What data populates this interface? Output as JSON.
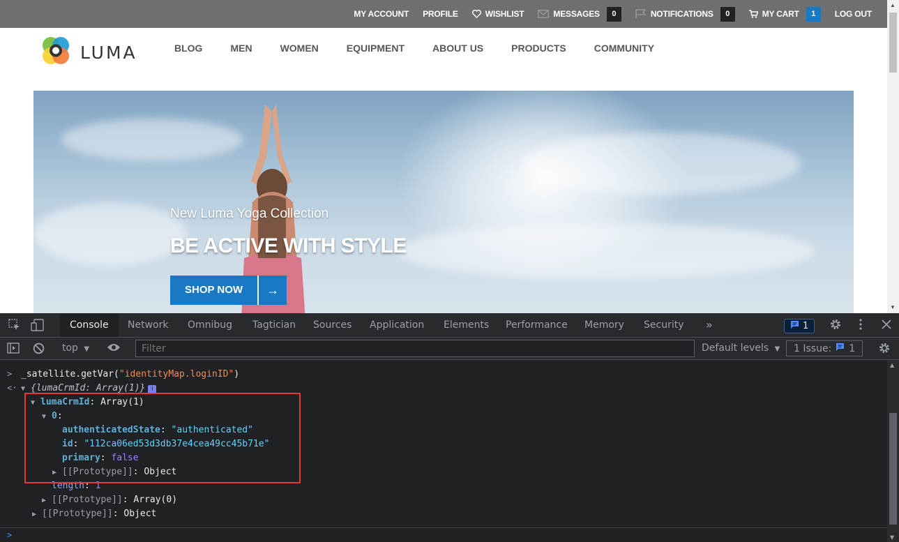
{
  "topbar": {
    "my_account": "MY ACCOUNT",
    "profile": "PROFILE",
    "wishlist": "WISHLIST",
    "messages": "MESSAGES",
    "messages_count": "0",
    "notifications": "NOTIFICATIONS",
    "notifications_count": "0",
    "my_cart": "MY CART",
    "cart_count": "1",
    "log_out": "LOG OUT"
  },
  "logo": {
    "text": "LUMA"
  },
  "nav": [
    {
      "label": "BLOG"
    },
    {
      "label": "MEN"
    },
    {
      "label": "WOMEN"
    },
    {
      "label": "EQUIPMENT"
    },
    {
      "label": "ABOUT US"
    },
    {
      "label": "PRODUCTS"
    },
    {
      "label": "COMMUNITY"
    }
  ],
  "hero": {
    "subtitle": "New Luma Yoga Collection",
    "title": "BE ACTIVE WITH STYLE",
    "button": "SHOP NOW",
    "button_arrow": "→"
  },
  "devtools": {
    "tabs": [
      "Console",
      "Network",
      "Omnibug",
      "Tagtician",
      "Sources",
      "Application",
      "Elements",
      "Performance",
      "Memory",
      "Security"
    ],
    "more_tabs": "»",
    "issues_badge_count": "1",
    "context": "top",
    "filter_placeholder": "Filter",
    "default_levels": "Default levels",
    "issues_label": "1 Issue:",
    "issues_count": "1"
  },
  "console": {
    "command_fn": "_satellite.getVar(",
    "command_arg": "\"identityMap.loginID\"",
    "command_close": ")",
    "result_preview": "{lumaCrmId: Array(1)}",
    "key_lumaCrmId": "lumaCrmId",
    "array_label": ": Array(1)",
    "index_0": "0",
    "key_authenticatedState": "authenticatedState",
    "val_authenticatedState": "\"authenticated\"",
    "key_id": "id",
    "val_id": "\"112ca06ed53d3db37e4cea49cc45b71e\"",
    "key_primary": "primary",
    "val_primary": "false",
    "proto_object": "[[Prototype]]",
    "proto_object_val": ": Object",
    "key_length": "length",
    "val_length": "1",
    "proto_array": "[[Prototype]]",
    "proto_array_val": ": Array(0)",
    "proto_outer": "[[Prototype]]",
    "proto_outer_val": ": Object"
  },
  "colors": {
    "topbar_bg": "#6f6f6f",
    "brand_blue": "#1979c3",
    "devtools_bg": "#202124",
    "highlight_red": "#e53935"
  }
}
